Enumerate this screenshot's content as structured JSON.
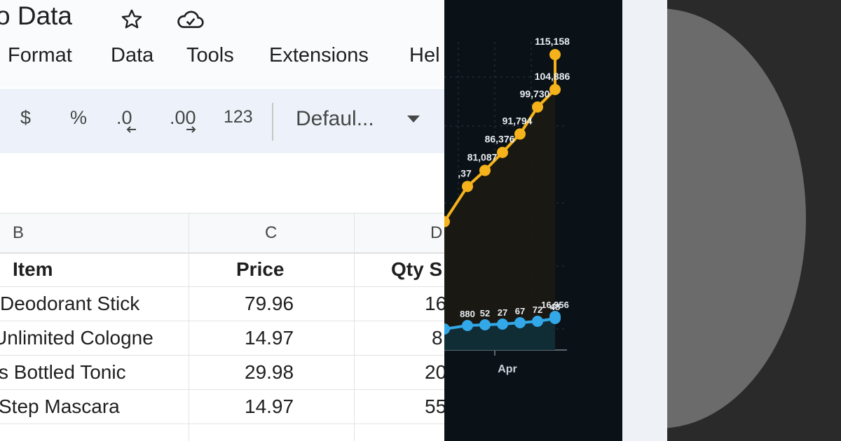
{
  "sheet": {
    "title": "o Data",
    "menu": [
      "Format",
      "Data",
      "Tools",
      "Extensions",
      "Hel"
    ],
    "toolbar": {
      "currency": "$",
      "percent": "%",
      "decrease_decimal": ".0",
      "increase_decimal": ".00",
      "number_format": "123",
      "font": "Defaul..."
    },
    "columns": [
      "B",
      "C",
      "D"
    ],
    "header": {
      "item": "Item",
      "price": "Price",
      "qty": "Qty S"
    },
    "rows": [
      {
        "item": "Deodorant Stick",
        "price": "79.96",
        "qty": "16"
      },
      {
        "item": "Unlimited Cologne",
        "price": "14.97",
        "qty": "8"
      },
      {
        "item": "s Bottled Tonic",
        "price": "29.98",
        "qty": "20"
      },
      {
        "item": "Step Mascara",
        "price": "14.97",
        "qty": "55"
      }
    ]
  },
  "chart_data": {
    "type": "line",
    "categories": [
      "",
      "",
      "",
      "",
      "",
      "",
      "",
      "Apr"
    ],
    "series": [
      {
        "values": [
          66000,
          76370,
          81087,
          86376,
          91794,
          99730,
          104886,
          115158
        ],
        "labels": [
          "",
          ",37",
          "81,087",
          "86,376",
          "91,794",
          "99,730",
          "104,886",
          "115,158"
        ],
        "color": "#f5b21a"
      },
      {
        "values": [
          0,
          0,
          0,
          0,
          0,
          0,
          0,
          0
        ],
        "labels": [
          "",
          "880",
          "52",
          "27",
          "67",
          "72",
          "48",
          "16,956"
        ],
        "color": "#33a8e8"
      }
    ],
    "xlabel": "Apr",
    "background": "#0b1217"
  },
  "colors": {
    "sheet_toolbar_bg": "#edf2fa",
    "chart_bg": "#0b1217",
    "circle": "#6b6b6b",
    "right_bg": "#2a2a2a"
  }
}
